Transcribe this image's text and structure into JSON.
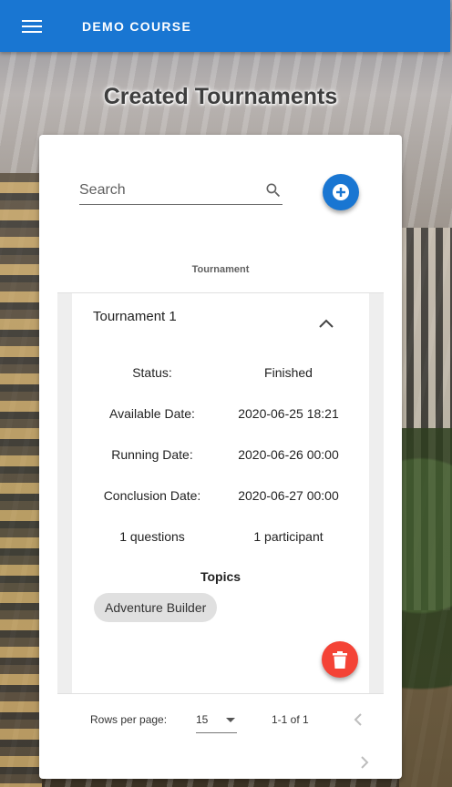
{
  "app": {
    "title": "DEMO COURSE",
    "menu_icon": "menu-icon"
  },
  "page": {
    "title": "Created Tournaments"
  },
  "search": {
    "placeholder": "Search",
    "icon": "search-icon"
  },
  "add_button": {
    "icon": "plus-icon"
  },
  "table": {
    "header": "Tournament",
    "tournament": {
      "name": "Tournament 1",
      "details": [
        {
          "label": "Status:",
          "value": "Finished"
        },
        {
          "label": "Available Date:",
          "value": "2020-06-25 18:21"
        },
        {
          "label": "Running Date:",
          "value": "2020-06-26 00:00"
        },
        {
          "label": "Conclusion Date:",
          "value": "2020-06-27 00:00"
        },
        {
          "label": "1 questions",
          "value": "1 participant"
        }
      ],
      "topics_label": "Topics",
      "topics": [
        "Adventure Builder"
      ],
      "delete_icon": "trash-icon"
    }
  },
  "pagination": {
    "rows_per_page_label": "Rows per page:",
    "rows_per_page_value": "15",
    "range": "1-1 of 1"
  },
  "colors": {
    "primary": "#1976d2",
    "danger": "#f44336",
    "chip": "#e0e0e0"
  }
}
